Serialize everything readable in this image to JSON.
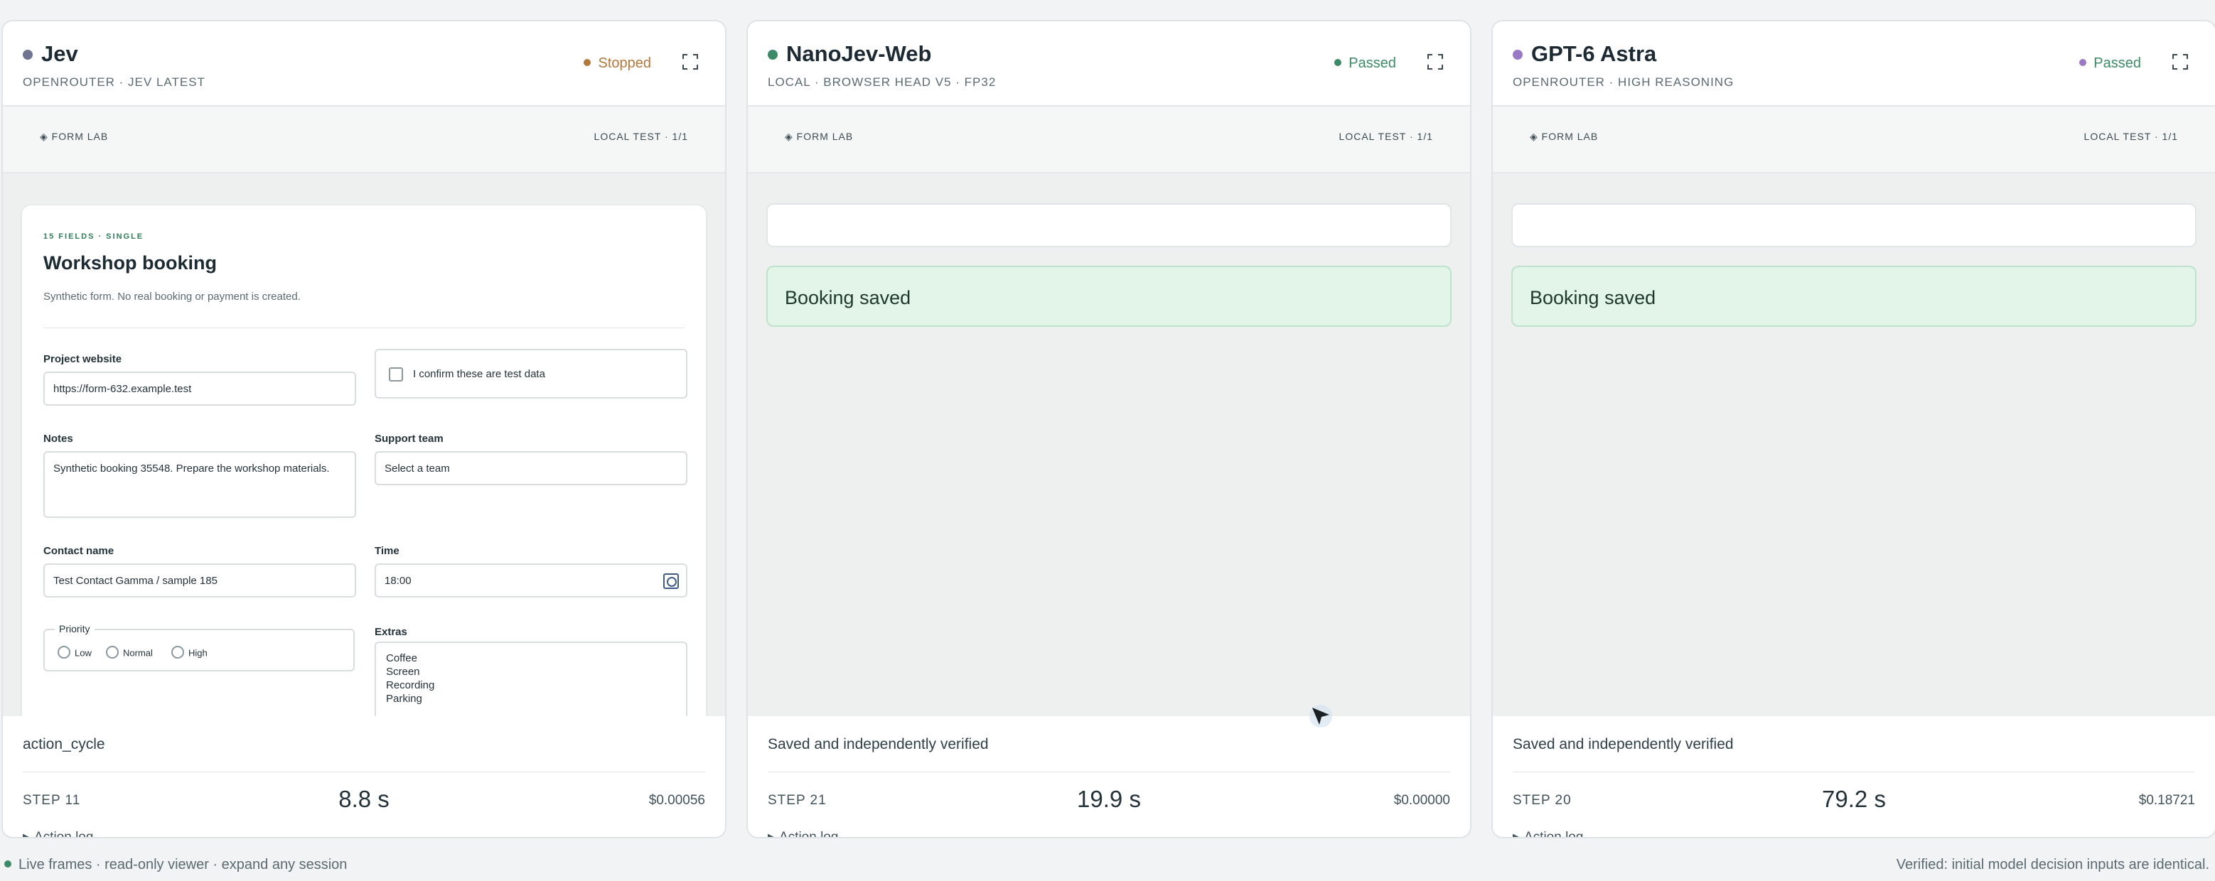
{
  "colors": {
    "jev_dot": "#6f7590",
    "nanojev_dot": "#3c8a67",
    "gpt_dot": "#9a7ac4",
    "stopped": "#b2773b",
    "passed": "#3c8a67",
    "live_dot": "#3c8a67"
  },
  "sessions": [
    {
      "name": "Jev",
      "subtitle": "OPENROUTER · JEV LATEST",
      "status": "Stopped",
      "lab": "◈ FORM LAB",
      "local_test": "LOCAL TEST · 1/1",
      "footer_message": "action_cycle",
      "step": "STEP 11",
      "time": "8.8 s",
      "cost": "$0.00056",
      "action_log": "Action log"
    },
    {
      "name": "NanoJev-Web",
      "subtitle": "LOCAL · BROWSER HEAD V5 · FP32",
      "status": "Passed",
      "lab": "◈ FORM LAB",
      "local_test": "LOCAL TEST · 1/1",
      "result": "Booking saved",
      "footer_message": "Saved and independently verified",
      "step": "STEP 21",
      "time": "19.9 s",
      "cost": "$0.00000",
      "action_log": "Action log"
    },
    {
      "name": "GPT-6 Astra",
      "subtitle": "OPENROUTER · HIGH REASONING",
      "status": "Passed",
      "lab": "◈ FORM LAB",
      "local_test": "LOCAL TEST · 1/1",
      "result": "Booking saved",
      "footer_message": "Saved and independently verified",
      "step": "STEP 20",
      "time": "79.2 s",
      "cost": "$0.18721",
      "action_log": "Action log"
    }
  ],
  "form": {
    "kicker": "15 FIELDS · SINGLE",
    "title": "Workshop booking",
    "description": "Synthetic form. No real booking or payment is created.",
    "project_website_label": "Project website",
    "project_website_value": "https://form-632.example.test",
    "confirm_label": "I confirm these are test data",
    "notes_label": "Notes",
    "notes_value": "Synthetic booking 35548. Prepare the workshop materials.",
    "support_team_label": "Support team",
    "support_team_value": "Select a team",
    "contact_name_label": "Contact name",
    "contact_name_value": "Test Contact Gamma / sample 185",
    "time_label": "Time",
    "time_value": "18:00",
    "priority_label": "Priority",
    "priority_options": [
      "Low",
      "Normal",
      "High"
    ],
    "extras_label": "Extras",
    "extras_options": [
      "Coffee",
      "Screen",
      "Recording",
      "Parking"
    ]
  },
  "footer": {
    "left": "Live frames · read-only viewer · expand any session",
    "right": "Verified: initial model decision inputs are identical."
  }
}
